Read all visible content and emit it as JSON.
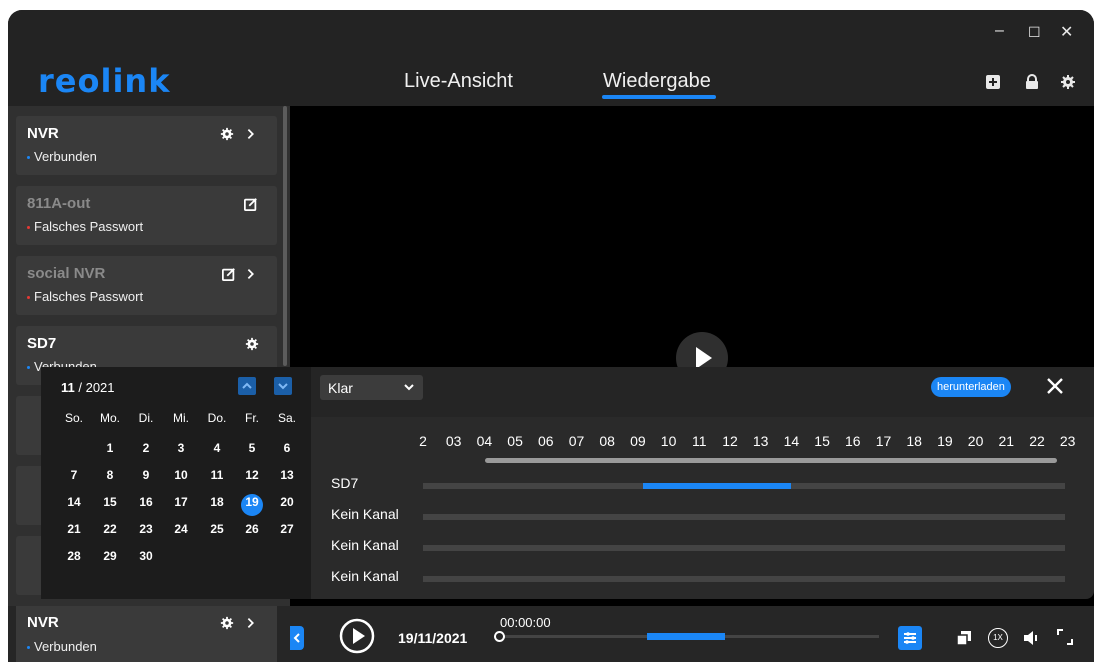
{
  "app": {
    "logo": "reolink"
  },
  "window_controls": {
    "minimize": "–",
    "maximize": "☐",
    "close": "✕"
  },
  "nav": {
    "live": "Live-Ansicht",
    "playback": "Wiedergabe"
  },
  "header_icons": [
    "add-icon",
    "lock-icon",
    "gear-icon"
  ],
  "colors": {
    "accent": "#1b86f5",
    "connected": "#1b86f5",
    "error": "#e53935"
  },
  "devices": [
    {
      "name": "NVR",
      "status": "Verbunden",
      "state": "connected"
    },
    {
      "name": "811A-out",
      "status": "Falsches Passwort",
      "state": "error"
    },
    {
      "name": "social NVR",
      "status": "Falsches Passwort",
      "state": "error"
    },
    {
      "name": "SD7",
      "status": "Verbunden",
      "state": "connected"
    },
    {
      "name": "NVR",
      "status": "Verbunden",
      "state": "connected"
    }
  ],
  "calendar": {
    "month": "11",
    "year": "/ 2021",
    "weekdays": [
      "So.",
      "Mo.",
      "Di.",
      "Mi.",
      "Do.",
      "Fr.",
      "Sa."
    ],
    "weeks": [
      [
        "",
        "1",
        "2",
        "3",
        "4",
        "5",
        "6"
      ],
      [
        "7",
        "8",
        "9",
        "10",
        "11",
        "12",
        "13"
      ],
      [
        "14",
        "15",
        "16",
        "17",
        "18",
        "19",
        "20"
      ],
      [
        "21",
        "22",
        "23",
        "24",
        "25",
        "26",
        "27"
      ],
      [
        "28",
        "29",
        "30",
        "",
        "",
        "",
        ""
      ]
    ],
    "selected_day": "19"
  },
  "timeline": {
    "stream": "Klar",
    "download": "herunterladen",
    "hours": [
      "2",
      "03",
      "04",
      "05",
      "06",
      "07",
      "08",
      "09",
      "10",
      "11",
      "12",
      "13",
      "14",
      "15",
      "16",
      "17",
      "18",
      "19",
      "20",
      "21",
      "22",
      "23"
    ],
    "channels": [
      "SD7",
      "Kein Kanal",
      "Kein Kanal",
      "Kein Kanal"
    ]
  },
  "playbar": {
    "date": "19/11/2021",
    "time": "00:00:00",
    "speed": "1X"
  }
}
